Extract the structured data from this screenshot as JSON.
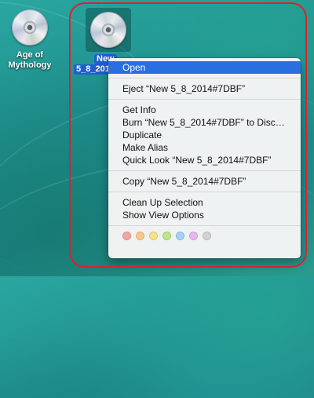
{
  "desktop": {
    "icons": [
      {
        "label_line1": "Age of",
        "label_line2": "Mythology"
      },
      {
        "label_line1": "New",
        "label_line2": "5_8_2014"
      }
    ]
  },
  "menu": {
    "open": "Open",
    "eject": "Eject “New 5_8_2014#7DBF”",
    "get_info": "Get Info",
    "burn": "Burn “New 5_8_2014#7DBF” to Disc…",
    "duplicate": "Duplicate",
    "make_alias": "Make Alias",
    "quick_look": "Quick Look “New 5_8_2014#7DBF”",
    "copy": "Copy “New 5_8_2014#7DBF”",
    "clean_up": "Clean Up Selection",
    "show_view_options": "Show View Options"
  },
  "tag_colors": [
    {
      "name": "red",
      "fill": "#f2a7a7",
      "stroke": "#e08a8a"
    },
    {
      "name": "orange",
      "fill": "#f6c88d",
      "stroke": "#e6ad67"
    },
    {
      "name": "yellow",
      "fill": "#f3e38a",
      "stroke": "#dcc96a"
    },
    {
      "name": "green",
      "fill": "#bfe48d",
      "stroke": "#a2cf6b"
    },
    {
      "name": "blue",
      "fill": "#a8d2f2",
      "stroke": "#84b8e2"
    },
    {
      "name": "purple",
      "fill": "#e7b9ef",
      "stroke": "#d29ad9"
    },
    {
      "name": "gray",
      "fill": "#d2d2d2",
      "stroke": "#b8b8b8"
    }
  ],
  "highlight_color": "#2a6fe0",
  "annotation_color": "#e0202a"
}
